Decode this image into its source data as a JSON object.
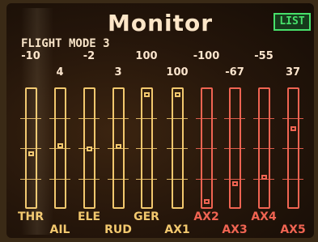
{
  "title": "Monitor",
  "list_button": "LIST",
  "flight_mode": "FLIGHT MODE 3",
  "colors": {
    "yellow": "#f2c86e",
    "red": "#f06452",
    "green": "#47e06a",
    "text": "#fbe5cd"
  },
  "channels": [
    {
      "name": "THR",
      "value": "-10",
      "level": 0.45,
      "color": "yellow"
    },
    {
      "name": "AIL",
      "value": "4",
      "level": 0.52,
      "color": "yellow"
    },
    {
      "name": "ELE",
      "value": "-2",
      "level": 0.49,
      "color": "yellow"
    },
    {
      "name": "RUD",
      "value": "3",
      "level": 0.515,
      "color": "yellow"
    },
    {
      "name": "GER",
      "value": "100",
      "level": 1.0,
      "color": "yellow"
    },
    {
      "name": "AX1",
      "value": "100",
      "level": 1.0,
      "color": "yellow"
    },
    {
      "name": "AX2",
      "value": "-100",
      "level": 0.0,
      "color": "red"
    },
    {
      "name": "AX3",
      "value": "-67",
      "level": 0.165,
      "color": "red"
    },
    {
      "name": "AX4",
      "value": "-55",
      "level": 0.225,
      "color": "red"
    },
    {
      "name": "AX5",
      "value": "37",
      "level": 0.685,
      "color": "red"
    }
  ]
}
